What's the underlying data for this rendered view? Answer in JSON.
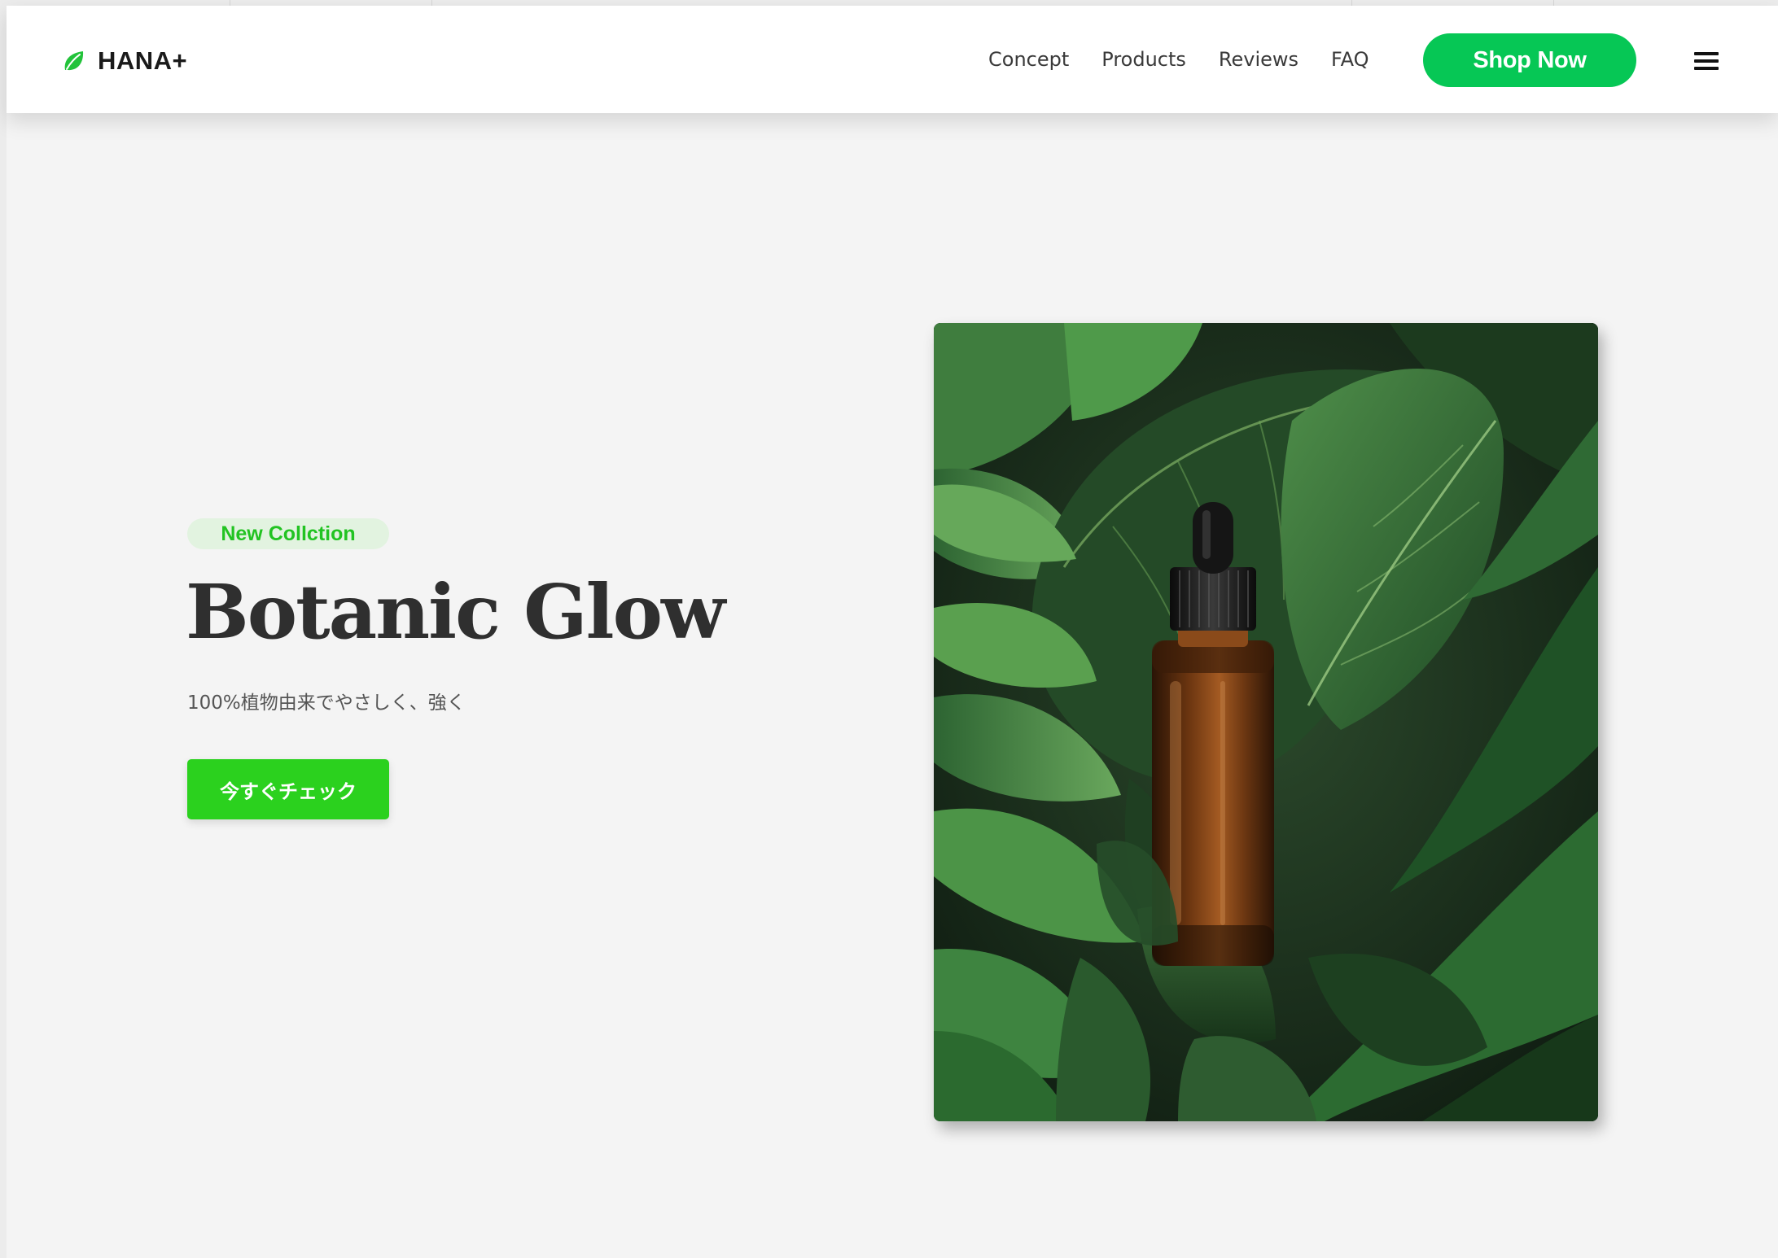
{
  "header": {
    "brand": "HANA+",
    "brand_icon": "leaf-icon",
    "nav": [
      {
        "label": "Concept"
      },
      {
        "label": "Products"
      },
      {
        "label": "Reviews"
      },
      {
        "label": "FAQ"
      }
    ],
    "shop_button_label": "Shop Now",
    "menu_icon": "hamburger-menu-icon"
  },
  "hero": {
    "badge": "New Collction",
    "title": "Botanic Glow",
    "subtitle": "100%植物由来でやさしく、強く",
    "cta_label": "今すぐチェック",
    "image_icon": "serum-bottle-on-leaves-image"
  },
  "colors": {
    "brand_green": "#06c755",
    "cta_green": "#2bd11e",
    "badge_bg": "#e2f3e0",
    "badge_text": "#22c322",
    "page_bg": "#f4f4f4",
    "title_text": "#2f2f2f"
  }
}
